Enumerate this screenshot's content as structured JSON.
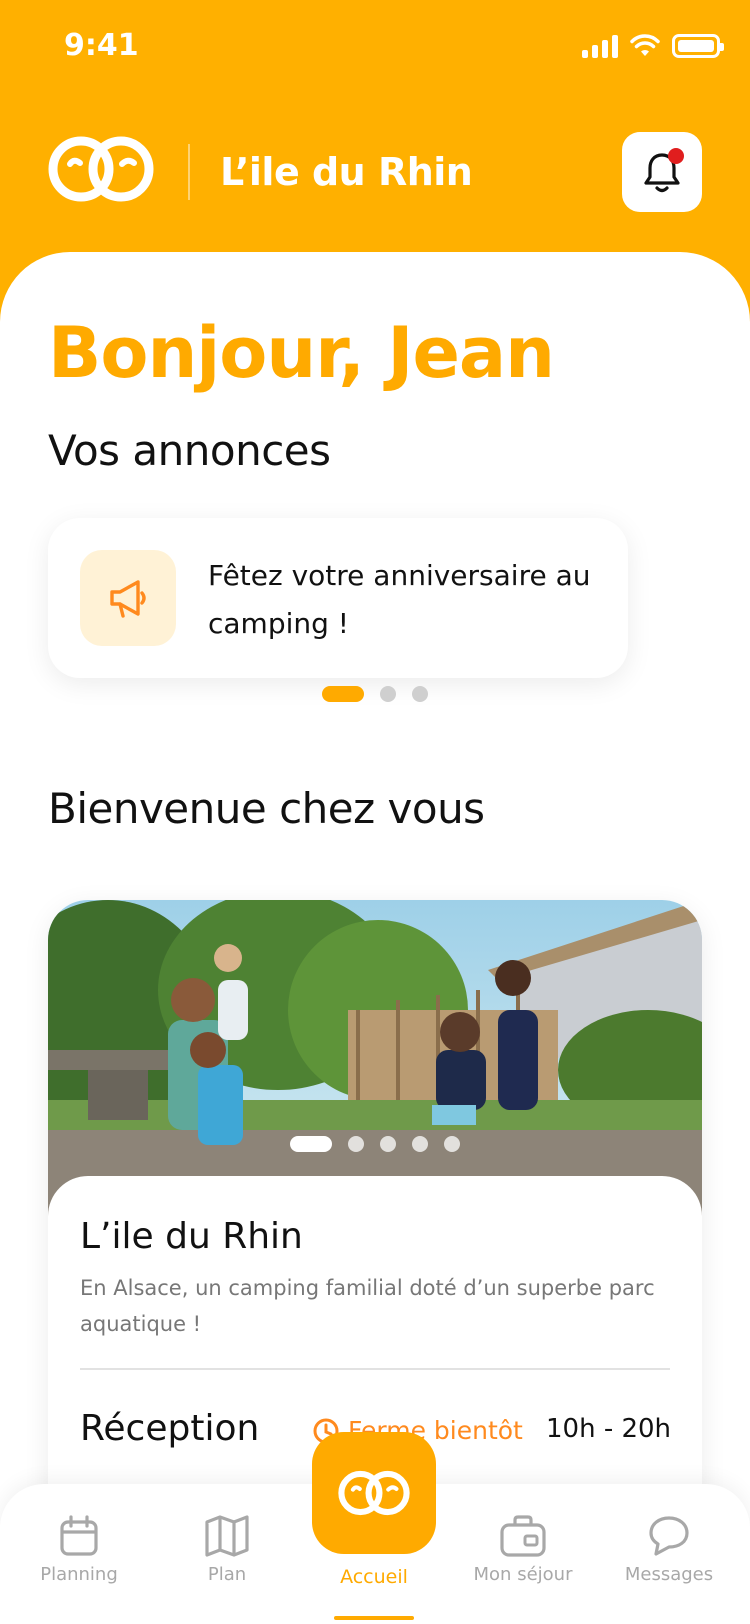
{
  "status_bar": {
    "time": "9:41"
  },
  "header": {
    "title": "L’ile du Rhin",
    "has_notification": true
  },
  "greeting": "Bonjour, Jean",
  "announcements": {
    "title": "Vos annonces",
    "items": [
      {
        "icon": "megaphone-icon",
        "text": "Fêtez votre anniversaire au camping !"
      }
    ],
    "page_count": 3,
    "active_page": 1
  },
  "welcome": {
    "title": "Bienvenue chez vous",
    "photo_count": 5,
    "active_photo": 1,
    "camping": {
      "name": "L’ile du Rhin",
      "description": "En Alsace, un camping familial doté d’un superbe parc aquatique !",
      "reception": {
        "label": "Réception",
        "status": "Ferme bientôt",
        "hours": "10h - 20h"
      }
    }
  },
  "nav": {
    "items": [
      {
        "label": "Planning",
        "icon": "calendar-icon"
      },
      {
        "label": "Plan",
        "icon": "map-icon"
      },
      {
        "label": "Accueil",
        "icon": "home-logo-icon",
        "active": true
      },
      {
        "label": "Mon séjour",
        "icon": "suitcase-icon"
      },
      {
        "label": "Messages",
        "icon": "chat-icon"
      }
    ]
  },
  "colors": {
    "primary": "#FFB000",
    "accent": "#FFAA00",
    "status_warning": "#FF8A1E",
    "notification": "#E01E1E"
  }
}
